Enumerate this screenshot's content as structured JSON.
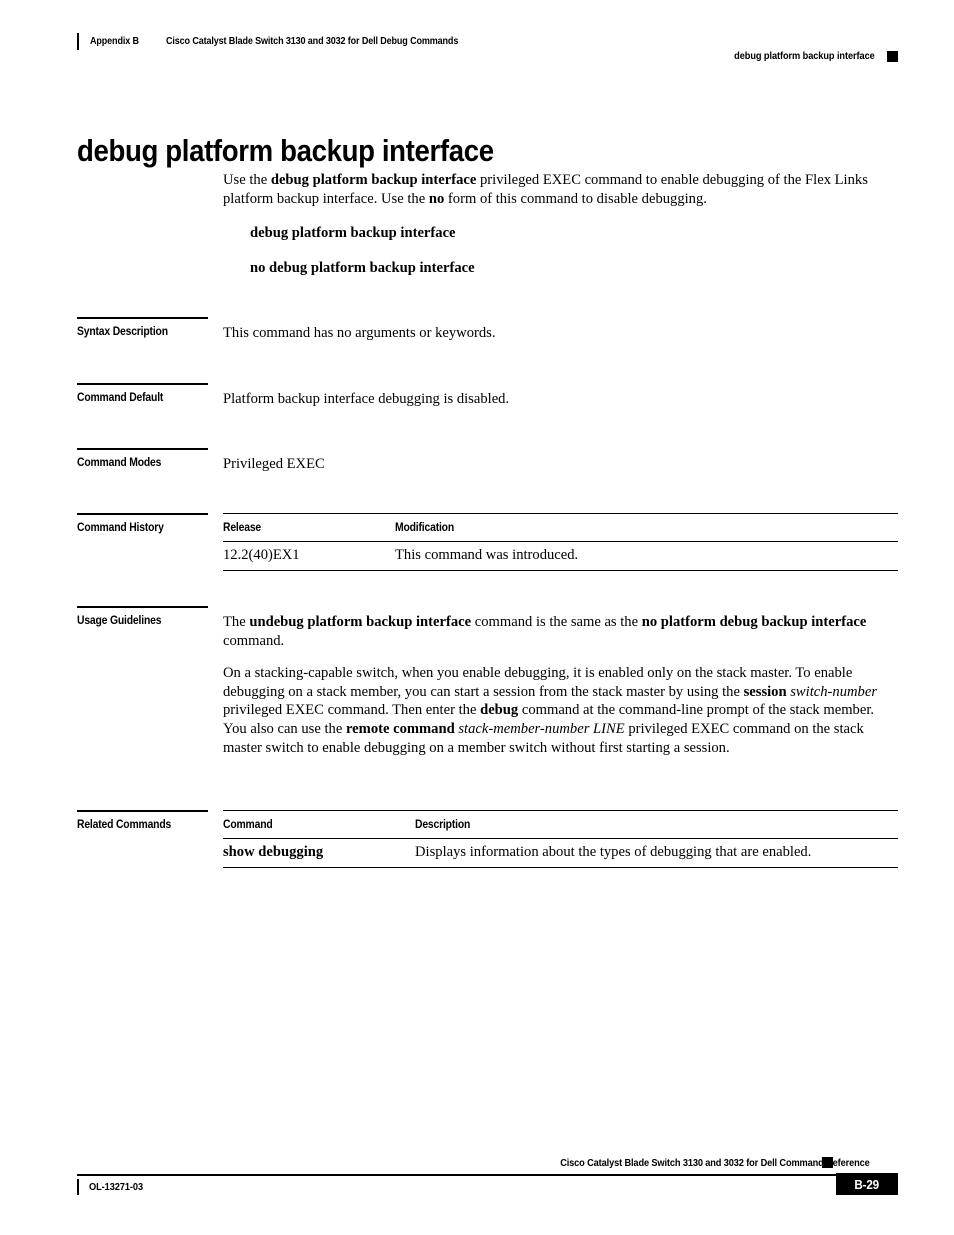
{
  "header": {
    "appendix": "Appendix B",
    "book_title": "Cisco Catalyst Blade Switch 3130 and 3032 for Dell Debug Commands",
    "command_name": "debug platform backup interface"
  },
  "title": "debug platform backup interface",
  "intro": {
    "part1": "Use the ",
    "bold1": "debug platform backup interface",
    "part2": " privileged EXEC command to enable debugging of the Flex Links platform backup interface. Use the ",
    "bold2": "no",
    "part3": " form of this command to disable debugging."
  },
  "syntax_lines": [
    "debug platform backup interface",
    "no debug platform backup interface"
  ],
  "sections": {
    "syntax_description": {
      "label": "Syntax Description",
      "body": "This command has no arguments or keywords."
    },
    "command_default": {
      "label": "Command Default",
      "body": "Platform backup interface debugging is disabled."
    },
    "command_modes": {
      "label": "Command Modes",
      "body": "Privileged EXEC"
    },
    "command_history": {
      "label": "Command History",
      "columns": [
        "Release",
        "Modification"
      ],
      "rows": [
        {
          "release": "12.2(40)EX1",
          "modification": "This command was introduced."
        }
      ]
    },
    "usage_guidelines": {
      "label": "Usage Guidelines",
      "para1": {
        "t1": "The ",
        "b1": "undebug platform backup interface",
        "t2": " command is the same as the ",
        "b2": "no platform debug backup interface",
        "t3": " command."
      },
      "para2": {
        "t1": "On a stacking-capable switch, when you enable debugging, it is enabled only on the stack master. To enable debugging on a stack member, you can start a session from the stack master by using the ",
        "b1": "session",
        "t2": " ",
        "i1": "switch-number",
        "t3": " privileged EXEC command. Then enter the ",
        "b2": "debug",
        "t4": " command at the command-line prompt of the stack member. You also can use the ",
        "b3": "remote command",
        "t5": " ",
        "i2": "stack-member-number LINE",
        "t6": " privileged EXEC command on the stack master switch to enable debugging on a member switch without first starting a session."
      }
    },
    "related_commands": {
      "label": "Related Commands",
      "columns": [
        "Command",
        "Description"
      ],
      "rows": [
        {
          "command": "show debugging",
          "description": "Displays information about the types of debugging that are enabled."
        }
      ]
    }
  },
  "footer": {
    "book_title": "Cisco Catalyst Blade Switch 3130 and 3032 for Dell Command Reference",
    "doc_id": "OL-13271-03",
    "page_number": "B-29"
  }
}
